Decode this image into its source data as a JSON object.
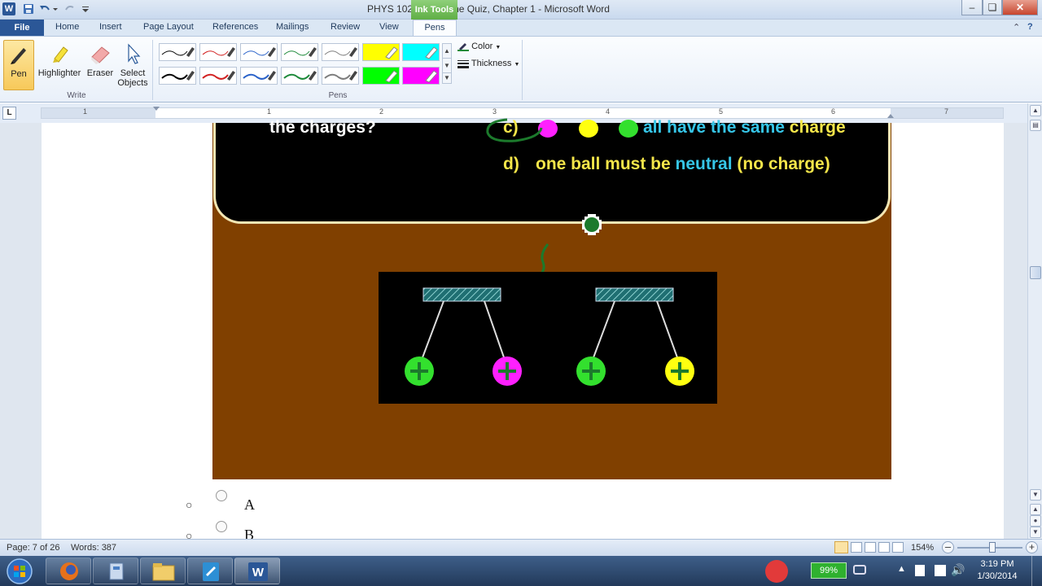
{
  "titlebar": {
    "title": "PHYS 102-S14 Online Quiz, Chapter 1  -  Microsoft Word",
    "context_tab": "Ink Tools"
  },
  "tabs": {
    "file": "File",
    "home": "Home",
    "insert": "Insert",
    "page_layout": "Page Layout",
    "references": "References",
    "mailings": "Mailings",
    "review": "Review",
    "view": "View",
    "pens": "Pens"
  },
  "ribbon": {
    "write_group": {
      "label": "Write",
      "pen": "Pen",
      "highlighter": "Highlighter",
      "eraser": "Eraser",
      "select_objects_line1": "Select",
      "select_objects_line2": "Objects"
    },
    "pens_group": {
      "label": "Pens",
      "color": "Color",
      "thickness": "Thickness",
      "swatches_row1": [
        "#000000",
        "#d22222",
        "#2a62c9",
        "#1d8a3a",
        "#7d7d7d",
        "#ffff00",
        "#00ffff"
      ],
      "swatches_row2": [
        "#000000",
        "#d22222",
        "#2a62c9",
        "#1d8a3a",
        "#7d7d7d",
        "#00ff00",
        "#ff00ff"
      ]
    }
  },
  "ruler": {
    "numbers": [
      "1",
      "1",
      "2",
      "3",
      "4",
      "5",
      "6",
      "7"
    ]
  },
  "slide": {
    "question_tail": "the charges?",
    "option_c_prefix": "c)",
    "option_c_part1": "all have the ",
    "option_c_highlight": "same",
    "option_c_part2": " charge",
    "option_d_prefix": "d)",
    "option_d_part1": "one ball must be ",
    "option_d_highlight": "neutral",
    "option_d_part2": "(no charge)",
    "colors": {
      "background": "#804000",
      "text": "#f5e64a",
      "highlight": "#36c6e8",
      "ink": "#1c7a2c"
    },
    "balls": [
      {
        "color": "#33e02e",
        "sign": "+"
      },
      {
        "color": "#ff20ff",
        "sign": "+"
      },
      {
        "color": "#33e02e",
        "sign": "+"
      },
      {
        "color": "#ffff10",
        "sign": "+"
      }
    ]
  },
  "answers": [
    {
      "letter": "A"
    },
    {
      "letter": "B"
    }
  ],
  "statusbar": {
    "page": "Page: 7 of 26",
    "words": "Words: 387",
    "zoom": "154%"
  },
  "taskbar": {
    "battery": "99%",
    "time": "3:19 PM",
    "date": "1/30/2014"
  }
}
